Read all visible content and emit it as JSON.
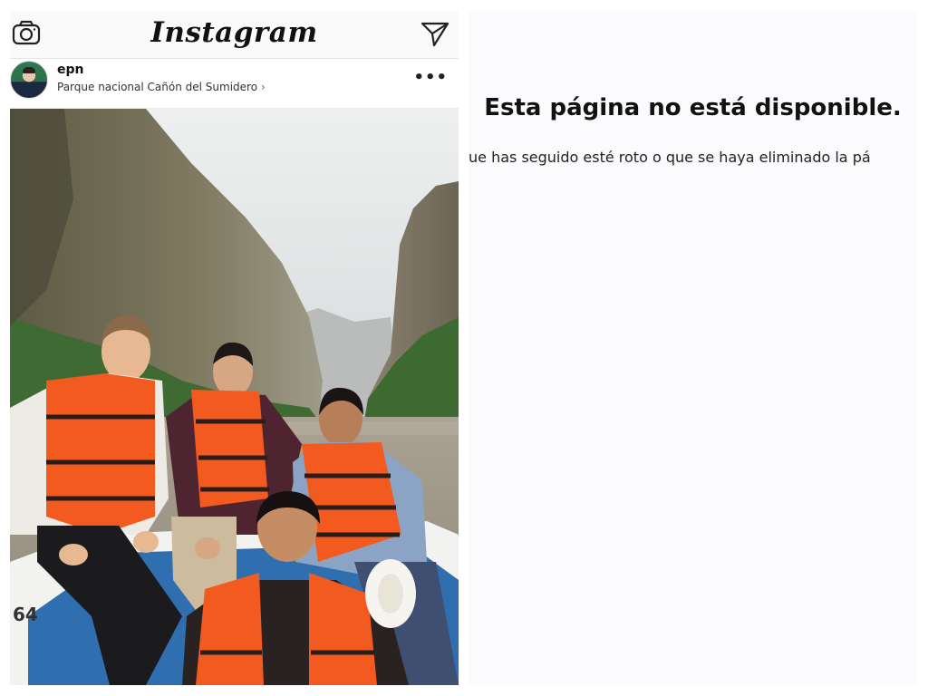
{
  "instagram": {
    "logo": "Instagram",
    "header_icons": [
      "camera-icon",
      "paper-plane-icon"
    ],
    "post": {
      "username": "epn",
      "location": "Parque nacional Cañón del Sumidero",
      "location_chevron": "›",
      "more_label": "•••",
      "boat_number": "64",
      "photo_description_icons": [
        "avatar",
        "canyon-photo"
      ]
    }
  },
  "unavailable_page": {
    "title": "Esta página no está disponible.",
    "message": "ue has seguido esté roto o que se haya eliminado la pá"
  }
}
